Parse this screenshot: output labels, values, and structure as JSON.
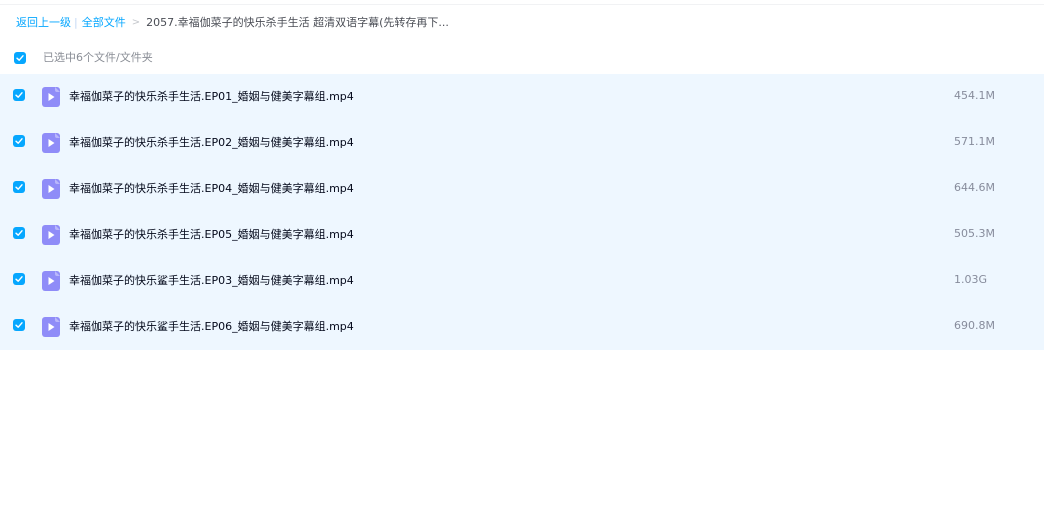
{
  "breadcrumb": {
    "back_label": "返回上一级",
    "separator_bar": "|",
    "all_files_label": "全部文件",
    "separator_arrow": ">",
    "current_folder": "2057.幸福伽菜子的快乐杀手生活 超清双语字幕(先转存再下..."
  },
  "selection": {
    "count_label": "已选中6个文件/文件夹"
  },
  "files": [
    {
      "name": "幸福伽菜子的快乐杀手生活.EP01_婚姻与健美字幕组.mp4",
      "size": "454.1M"
    },
    {
      "name": "幸福伽菜子的快乐杀手生活.EP02_婚姻与健美字幕组.mp4",
      "size": "571.1M"
    },
    {
      "name": "幸福伽菜子的快乐杀手生活.EP04_婚姻与健美字幕组.mp4",
      "size": "644.6M"
    },
    {
      "name": "幸福伽菜子的快乐杀手生活.EP05_婚姻与健美字幕组.mp4",
      "size": "505.3M"
    },
    {
      "name": "幸福伽菜子的快乐鲨手生活.EP03_婚姻与健美字幕组.mp4",
      "size": "1.03G"
    },
    {
      "name": "幸福伽菜子的快乐鲨手生活.EP06_婚姻与健美字幕组.mp4",
      "size": "690.8M"
    }
  ],
  "colors": {
    "accent": "#06a7ff",
    "row_selected_bg": "#eef7ff",
    "video_icon": "#8f8cf8"
  },
  "icons": {
    "checkbox": "checked-checkbox-icon",
    "file_type": "video-file-icon"
  }
}
